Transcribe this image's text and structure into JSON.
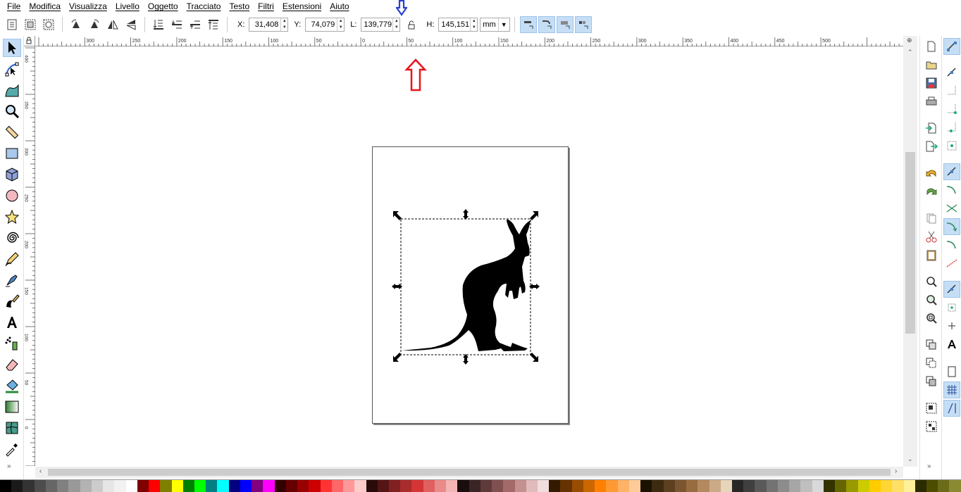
{
  "menu": [
    "File",
    "Modifica",
    "Visualizza",
    "Livello",
    "Oggetto",
    "Tracciato",
    "Testo",
    "Filtri",
    "Estensioni",
    "Aiuto"
  ],
  "controls": {
    "x_label": "X:",
    "x_value": "31,408",
    "y_label": "Y:",
    "y_value": "74,079",
    "w_label": "L:",
    "w_value": "139,779",
    "h_label": "H:",
    "h_value": "145,151",
    "unit": "mm"
  },
  "hruler_labels": [
    "|300",
    "|250",
    "|200",
    "|150",
    "|100",
    "|50",
    "|0",
    "|50",
    "|100",
    "|150",
    "|200",
    "|250",
    "|300",
    "|350",
    "|400",
    "|450",
    "|500"
  ],
  "vruler_labels": [
    "400",
    "350",
    "300",
    "250",
    "200",
    "150",
    "100",
    "50",
    "0",
    "50"
  ],
  "colors": {
    "accent_active": "#c5def5",
    "annotation_red": "#e8141b",
    "annotation_blue": "#2a3fd1",
    "palette": [
      "#000000",
      "#1a1a1a",
      "#333333",
      "#4d4d4d",
      "#666666",
      "#808080",
      "#999999",
      "#b3b3b3",
      "#cccccc",
      "#e6e6e6",
      "#f2f2f2",
      "#ffffff",
      "#800000",
      "#ff0000",
      "#808000",
      "#ffff00",
      "#008000",
      "#00ff00",
      "#008080",
      "#00ffff",
      "#000080",
      "#0000ff",
      "#800080",
      "#ff00ff",
      "#330000",
      "#660000",
      "#990000",
      "#cc0000",
      "#ff3333",
      "#ff6666",
      "#ff9999",
      "#ffcccc",
      "#2b0a0a",
      "#551515",
      "#802020",
      "#aa2b2b",
      "#d53535",
      "#e06060",
      "#eb8a8a",
      "#f5b5b5",
      "#1a0d0d",
      "#3b2424",
      "#5e3a3a",
      "#805050",
      "#a36a6a",
      "#c59090",
      "#e0bbbb",
      "#f0dddd",
      "#331a00",
      "#663300",
      "#994d00",
      "#cc6600",
      "#ff8000",
      "#ff9933",
      "#ffb366",
      "#ffcc99",
      "#1a1300",
      "#3d2b10",
      "#5c4020",
      "#7a5530",
      "#996b40",
      "#b38a60",
      "#ccaa88",
      "#e6d4bb",
      "#262626",
      "#3f3f3f",
      "#595959",
      "#737373",
      "#8c8c8c",
      "#a6a6a6",
      "#bfbfbf",
      "#d9d9d9",
      "#333300",
      "#666600",
      "#999900",
      "#cccc00",
      "#ffcc00",
      "#ffd633",
      "#ffe066",
      "#fff099",
      "#2b2b00",
      "#4d4d00",
      "#6b6b1a",
      "#8a8a33"
    ]
  }
}
